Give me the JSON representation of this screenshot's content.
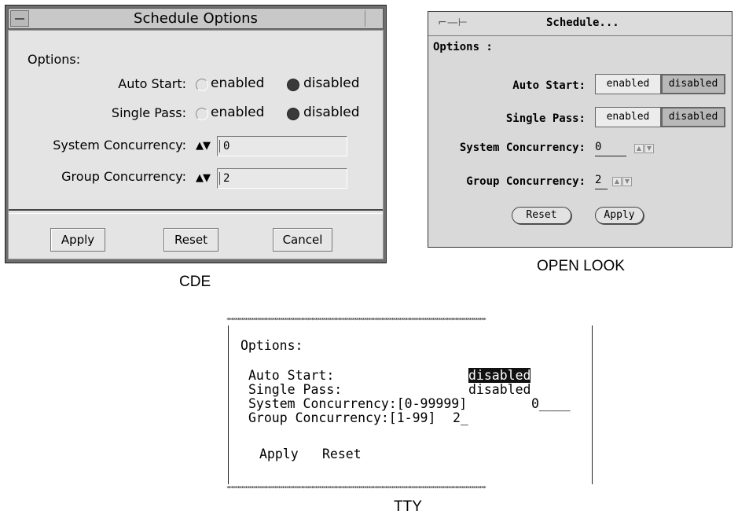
{
  "cde": {
    "title": "Schedule Options",
    "options_label": "Options:",
    "auto_start_label": "Auto Start:",
    "single_pass_label": "Single Pass:",
    "enabled_label": "enabled",
    "disabled_label": "disabled",
    "system_concurrency_label": "System Concurrency:",
    "system_concurrency_value": "0",
    "group_concurrency_label": "Group Concurrency:",
    "group_concurrency_value": "2",
    "spin_glyph": "▲▼",
    "apply": "Apply",
    "reset": "Reset",
    "cancel": "Cancel",
    "caption": "CDE"
  },
  "openlook": {
    "title": "Schedule...",
    "options_label": "Options :",
    "auto_start_label": "Auto Start:",
    "single_pass_label": "Single Pass:",
    "enabled_label": "enabled",
    "disabled_label": "disabled",
    "system_concurrency_label": "System Concurrency:",
    "system_concurrency_value": "0",
    "group_concurrency_label": "Group Concurrency:",
    "group_concurrency_value": "2",
    "reset": "Reset",
    "apply": "Apply",
    "caption": "OPEN LOOK"
  },
  "tty": {
    "options_label": "Options:",
    "auto_start_label": "Auto Start:",
    "auto_start_value": "disabled",
    "single_pass_label": "Single Pass:",
    "single_pass_value": "disabled",
    "system_concurrency_label": "System Concurrency:[0-99999]",
    "system_concurrency_value": "0____",
    "group_concurrency_label": "Group Concurrency:[1-99]",
    "group_concurrency_value": "2_",
    "apply": "Apply",
    "reset": "Reset",
    "caption": "TTY"
  },
  "colors": {
    "cde_background": "#e4e4e4",
    "openlook_background": "#d9d9d9",
    "tty_highlight": "#111111"
  }
}
